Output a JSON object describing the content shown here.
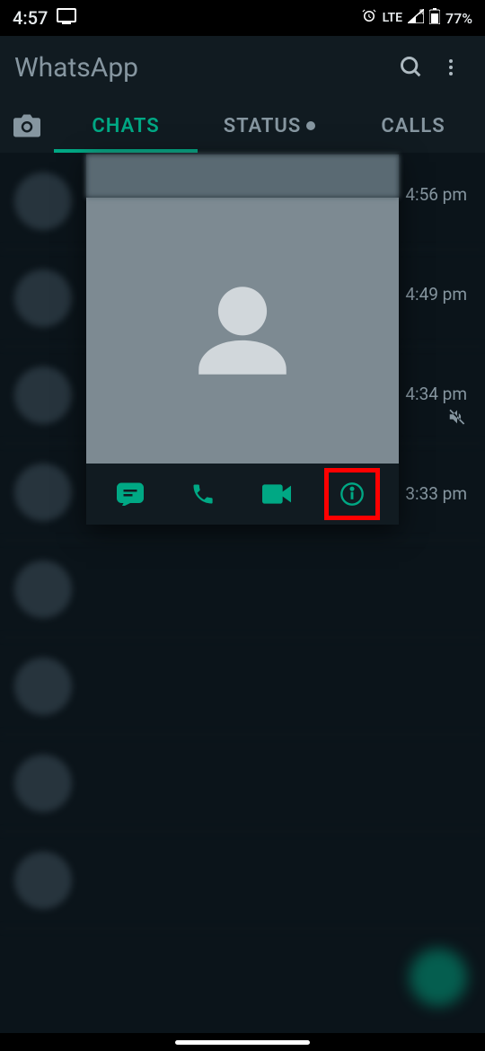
{
  "statusBar": {
    "time": "4:57",
    "network": "LTE",
    "battery": "77%"
  },
  "header": {
    "title": "WhatsApp"
  },
  "tabs": {
    "chats": "CHATS",
    "status": "STATUS",
    "calls": "CALLS"
  },
  "chats": [
    {
      "time": "4:56 pm"
    },
    {
      "time": "4:49 pm"
    },
    {
      "time": "4:34 pm"
    },
    {
      "time": "3:33 pm"
    }
  ],
  "popup": {
    "actions": {
      "message": "message-icon",
      "call": "call-icon",
      "video": "video-icon",
      "info": "info-icon"
    }
  }
}
